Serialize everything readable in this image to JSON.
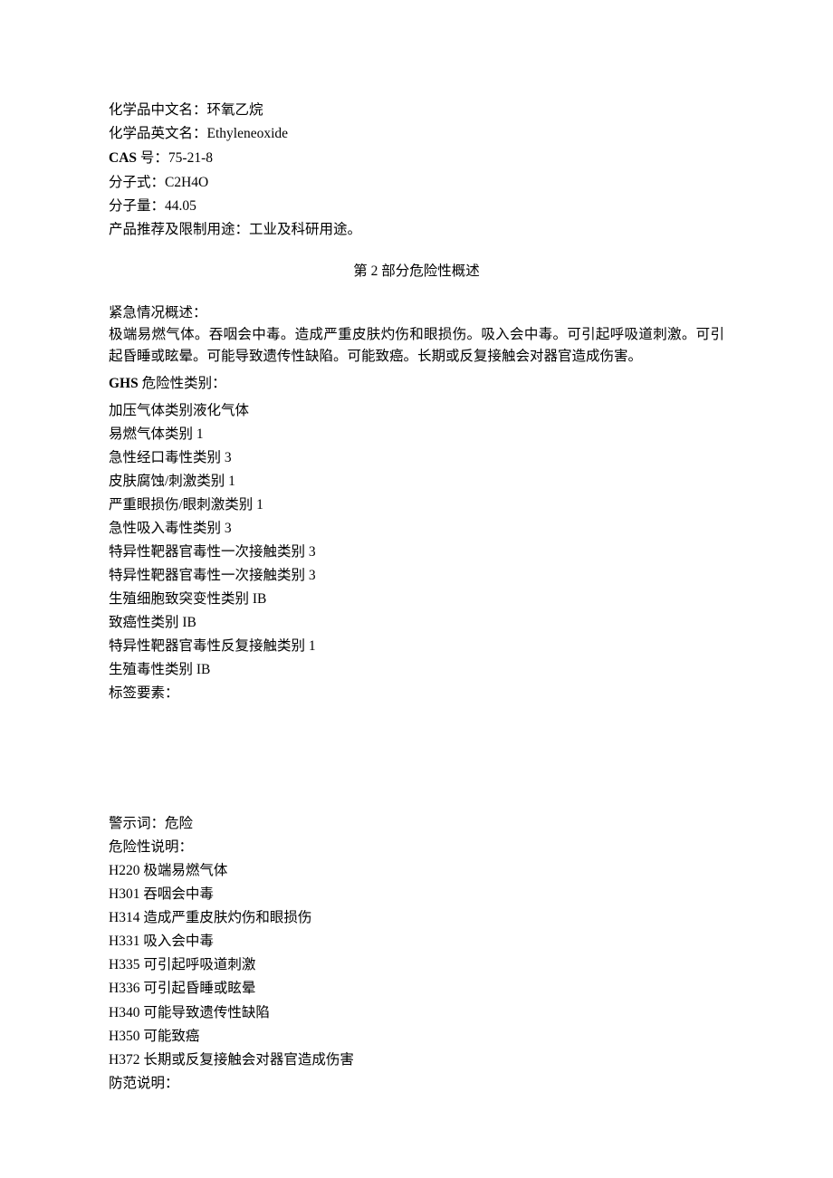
{
  "section1": {
    "cn_name_label": "化学品中文名：",
    "cn_name": "环氧乙烷",
    "en_name_label": "化学品英文名：",
    "en_name": "Ethyleneoxide",
    "cas_label_en": "CAS",
    "cas_label_cn": "号：",
    "cas": "75-21-8",
    "formula_label": "分子式：",
    "formula": "C2H4O",
    "mw_label": "分子量：",
    "mw": "44.05",
    "use_label": "产品推荐及限制用途：",
    "use": "工业及科研用途。"
  },
  "section2_heading": "第 2 部分危险性概述",
  "emergency": {
    "label": "紧急情况概述：",
    "text": "极端易燃气体。吞咽会中毒。造成严重皮肤灼伤和眼损伤。吸入会中毒。可引起呼吸道刺激。可引起昏睡或眩晕。可能导致遗传性缺陷。可能致癌。长期或反复接触会对器官造成伤害。"
  },
  "ghs": {
    "label_en": "GHS",
    "label_cn": "危险性类别：",
    "cats": [
      "加压气体类别液化气体",
      "易燃气体类别 1",
      "急性经口毒性类别 3",
      "皮肤腐蚀/刺激类别 1",
      "严重眼损伤/眼刺激类别 1",
      "急性吸入毒性类别 3",
      "特异性靶器官毒性一次接触类别 3",
      "特异性靶器官毒性一次接触类别 3",
      "生殖细胞致突变性类别 IB",
      "致癌性类别 IB",
      "特异性靶器官毒性反复接触类别 1",
      "生殖毒性类别 IB"
    ],
    "label_elements": "标签要素："
  },
  "signal": {
    "label": "警示词：",
    "value": "危险"
  },
  "hazard_stmt_label": "危险性说明：",
  "hstatements": [
    {
      "code": "H220",
      "text": "极端易燃气体"
    },
    {
      "code": "H301",
      "text": "吞咽会中毒"
    },
    {
      "code": "H314",
      "text": "造成严重皮肤灼伤和眼损伤"
    },
    {
      "code": "H331",
      "text": "吸入会中毒"
    },
    {
      "code": "H335",
      "text": "可引起呼吸道刺激"
    },
    {
      "code": "H336",
      "text": "可引起昏睡或眩晕"
    },
    {
      "code": "H340",
      "text": "可能导致遗传性缺陷"
    },
    {
      "code": "H350",
      "text": "可能致癌"
    },
    {
      "code": "H372",
      "text": "长期或反复接触会对器官造成伤害"
    }
  ],
  "precaution_label": "防范说明："
}
